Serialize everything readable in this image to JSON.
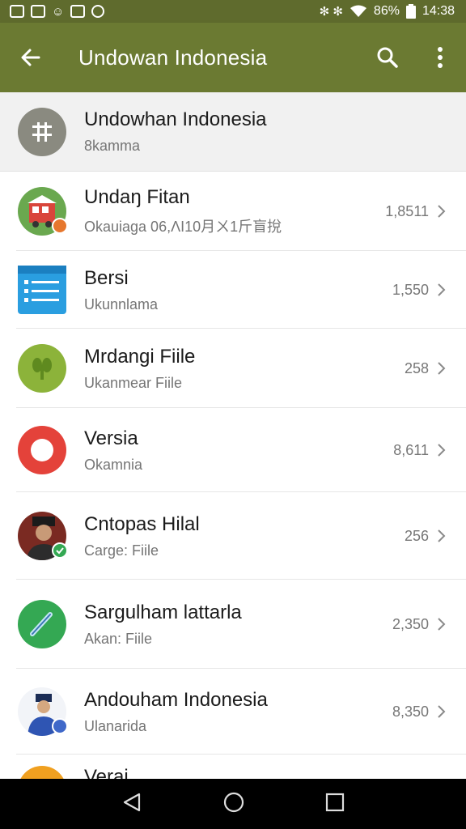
{
  "status": {
    "battery": "86%",
    "time": "14:38",
    "carrier_glyphs": "✻ ✻"
  },
  "app_bar": {
    "title": "Undowan Indonesia"
  },
  "header_item": {
    "title": "Undowhan Indonesia",
    "subtitle": "8kamma"
  },
  "items": [
    {
      "title": "Undaŋ Fitan",
      "subtitle": "Okauiaga 06,ΛΙ10月ㄨ1斤盲挩",
      "count": "1,8511",
      "icon": "train-icon"
    },
    {
      "title": "Bersi",
      "subtitle": "Ukunnlama",
      "count": "1,550",
      "icon": "list-doc-icon"
    },
    {
      "title": "Mrdangi Fiile",
      "subtitle": "Ukanmear Fiile",
      "count": "258",
      "icon": "plant-icon"
    },
    {
      "title": "Versia",
      "subtitle": "Okamnia",
      "count": "8,611",
      "icon": "ring-icon"
    },
    {
      "title": "Cntopas Hilal",
      "subtitle": "Carge: Fiile",
      "count": "256",
      "icon": "person-photo-icon"
    },
    {
      "title": "Sargulham lattarla",
      "subtitle": "Akan: Fiile",
      "count": "2,350",
      "icon": "pencil-icon"
    },
    {
      "title": "Andouham Indonesia",
      "subtitle": "Ulanarida",
      "count": "8,350",
      "icon": "person-photo-icon"
    },
    {
      "title": "Verai",
      "subtitle": "",
      "count": "",
      "icon": "orange-circle-icon"
    }
  ],
  "colors": {
    "status_bar": "#5f6b2d",
    "app_bar": "#6b7a32",
    "header_bg": "#f1f1f1",
    "nav_bar": "#000000"
  }
}
